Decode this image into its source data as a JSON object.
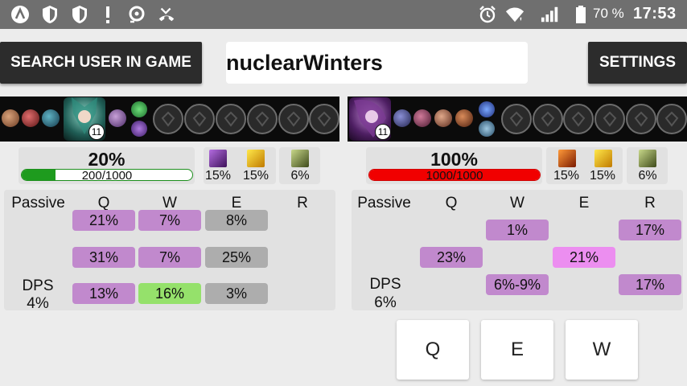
{
  "status_bar": {
    "icons": [
      "app-logo-icon",
      "shield-icon",
      "shield-half-icon",
      "alert-icon",
      "sync-icon",
      "missed-call-icon"
    ],
    "right_icons": [
      "alarm-icon",
      "wifi-icon",
      "signal-icon",
      "battery-icon"
    ],
    "battery": "70 %",
    "time": "17:53"
  },
  "toolbar": {
    "search_label": "SEARCH USER IN GAME",
    "username_value": "nuclearWinters",
    "settings_label": "SETTINGS"
  },
  "players": [
    {
      "level": "11",
      "hp_percent": "20%",
      "hp_text": "200/1000",
      "hp_fraction": 0.2,
      "hp_color": "#1e9b1e",
      "runes": [
        {
          "icon": "dark-rune-icon",
          "pct": "15%"
        },
        {
          "icon": "lightning-rune-icon",
          "pct": "15%"
        },
        {
          "icon": "gauntlet-rune-icon",
          "pct": "6%"
        }
      ],
      "abilities": {
        "headers": [
          "Passive",
          "Q",
          "W",
          "E",
          "R"
        ],
        "rows": [
          [
            "",
            "21%",
            "7%",
            "8%",
            ""
          ],
          [
            "",
            "31%",
            "7%",
            "25%",
            ""
          ],
          [
            "",
            "13%",
            "16%",
            "3%",
            ""
          ]
        ],
        "dps_label": "DPS",
        "dps_value": "4%"
      }
    },
    {
      "level": "11",
      "hp_percent": "100%",
      "hp_text": "1000/1000",
      "hp_fraction": 1.0,
      "hp_color": "#f10000",
      "runes": [
        {
          "icon": "fire-rune-icon",
          "pct": "15%"
        },
        {
          "icon": "lightning-rune-icon",
          "pct": "15%"
        },
        {
          "icon": "gauntlet-rune-icon",
          "pct": "6%"
        }
      ],
      "abilities": {
        "headers": [
          "Passive",
          "Q",
          "W",
          "E",
          "R"
        ],
        "rows": [
          [
            "",
            "",
            "1%",
            "",
            "17%"
          ],
          [
            "",
            "23%",
            "",
            "21%",
            ""
          ],
          [
            "",
            "",
            "6%-9%",
            "",
            "17%"
          ]
        ],
        "dps_label": "DPS",
        "dps_value": "6%"
      }
    }
  ],
  "keys": [
    "Q",
    "E",
    "W"
  ]
}
